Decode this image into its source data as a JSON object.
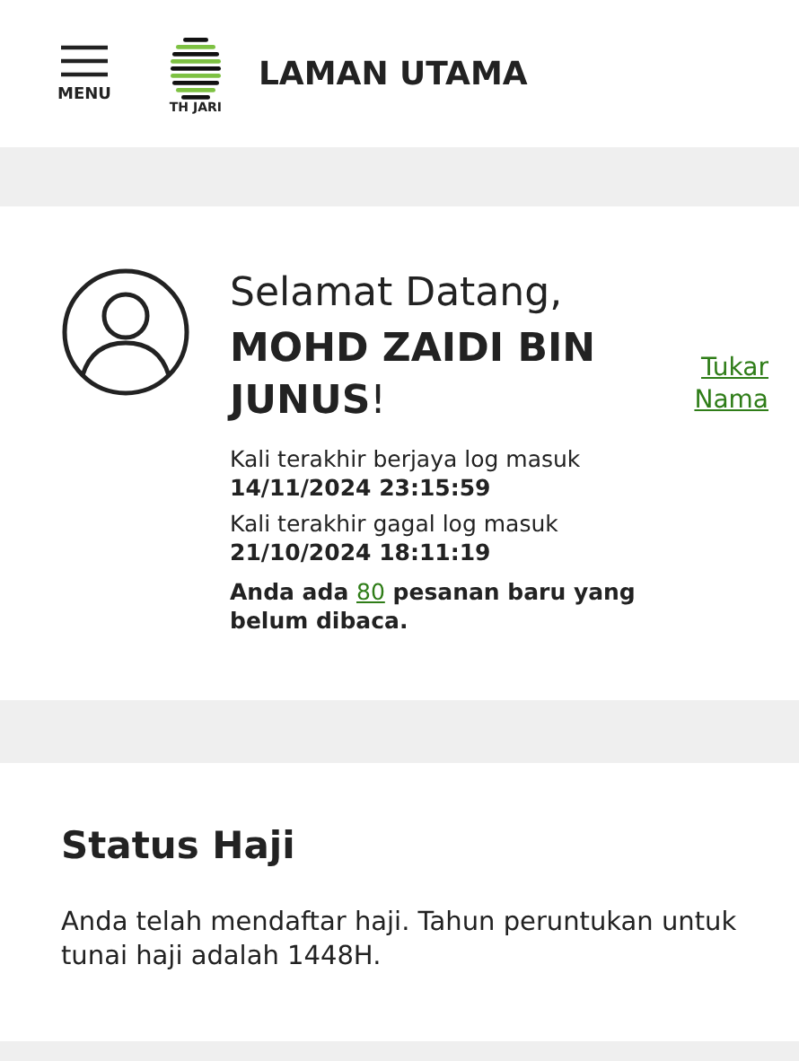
{
  "header": {
    "menu_label": "MENU",
    "logo_text": "TH JARI",
    "title": "LAMAN UTAMA"
  },
  "welcome": {
    "greeting": "Selamat Datang,",
    "name": "**MOHD ZAIDI BIN JUNUS**!",
    "change_name_link": "Tukar Nama",
    "logins": [
      {
        "label": "Kali terakhir berjaya log masuk",
        "time": "14/11/2024 23:15:59"
      },
      {
        "label": "Kali terakhir gagal log masuk",
        "time": "21/10/2024 18:11:19"
      }
    ],
    "messages": {
      "before": "Anda ada",
      "count": "80",
      "after": "pesanan baru yang belum dibaca."
    }
  },
  "hajj_status": {
    "title": "Status Haji",
    "text": "Anda telah mendaftar haji. Tahun peruntukan untuk tunai haji adalah 1448H."
  }
}
